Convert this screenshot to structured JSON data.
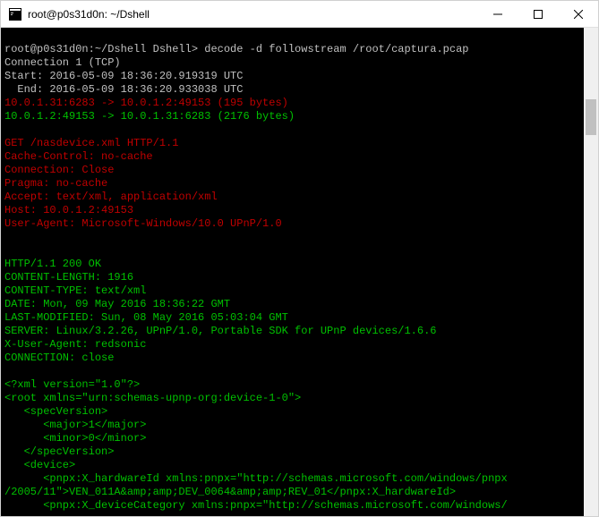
{
  "window": {
    "title": "root@p0s31d0n: ~/Dshell"
  },
  "prompt": {
    "text": "root@p0s31d0n:~/Dshell Dshell> decode -d followstream /root/captura.pcap"
  },
  "lines": {
    "conn": "Connection 1 (TCP)",
    "start": "Start: 2016-05-09 18:36:20.919319 UTC",
    "end": "  End: 2016-05-09 18:36:20.933038 UTC",
    "flow1": "10.0.1.31:6283 -> 10.0.1.2:49153 (195 bytes)",
    "flow2": "10.0.1.2:49153 -> 10.0.1.31:6283 (2176 bytes)",
    "req1": "GET /nasdevice.xml HTTP/1.1",
    "req2": "Cache-Control: no-cache",
    "req3": "Connection: Close",
    "req4": "Pragma: no-cache",
    "req5": "Accept: text/xml, application/xml",
    "req6": "Host: 10.0.1.2:49153",
    "req7": "User-Agent: Microsoft-Windows/10.0 UPnP/1.0",
    "res1": "HTTP/1.1 200 OK",
    "res2": "CONTENT-LENGTH: 1916",
    "res3": "CONTENT-TYPE: text/xml",
    "res4": "DATE: Mon, 09 May 2016 18:36:22 GMT",
    "res5": "LAST-MODIFIED: Sun, 08 May 2016 05:03:04 GMT",
    "res6": "SERVER: Linux/3.2.26, UPnP/1.0, Portable SDK for UPnP devices/1.6.6",
    "res7": "X-User-Agent: redsonic",
    "res8": "CONNECTION: close",
    "xml1": "<?xml version=\"1.0\"?>",
    "xml2": "<root xmlns=\"urn:schemas-upnp-org:device-1-0\">",
    "xml3": "   <specVersion>",
    "xml4": "      <major>1</major>",
    "xml5": "      <minor>0</minor>",
    "xml6": "   </specVersion>",
    "xml7": "   <device>",
    "xml8": "      <pnpx:X_hardwareId xmlns:pnpx=\"http://schemas.microsoft.com/windows/pnpx",
    "xml9": "/2005/11\">VEN_011A&amp;amp;DEV_0064&amp;amp;REV_01</pnpx:X_hardwareId>",
    "xml10": "      <pnpx:X_deviceCategory xmlns:pnpx=\"http://schemas.microsoft.com/windows/"
  }
}
